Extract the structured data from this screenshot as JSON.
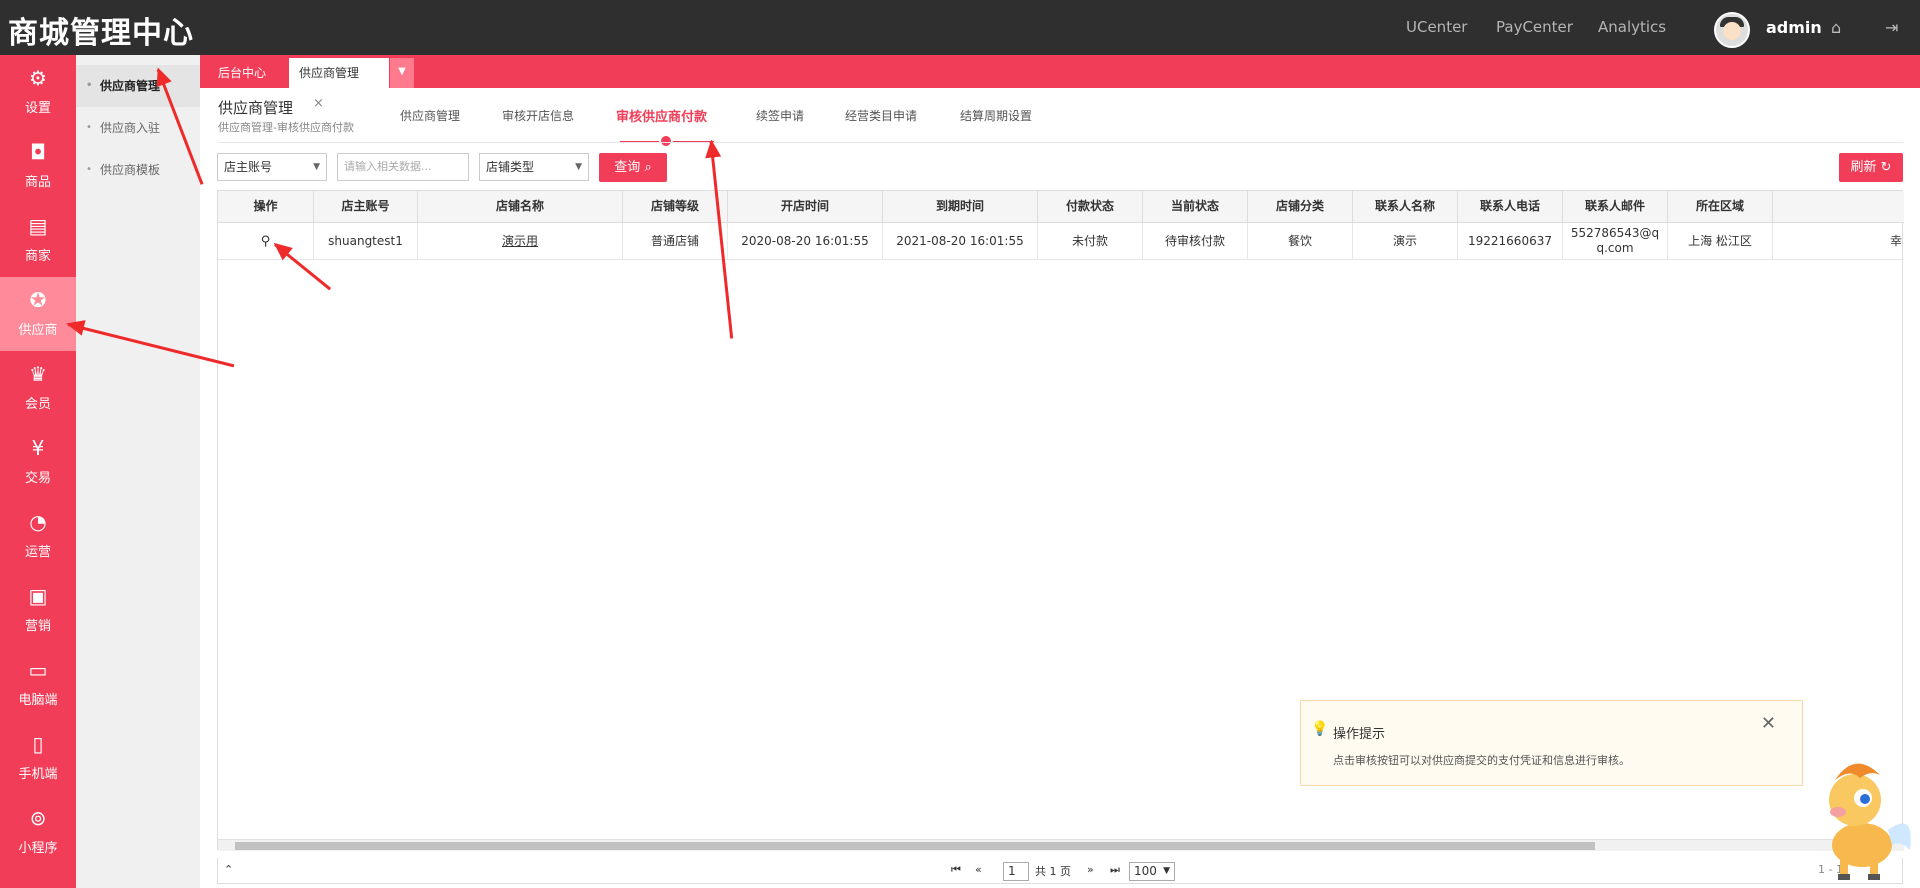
{
  "header": {
    "logo": "商城管理中心",
    "links": [
      "UCenter",
      "PayCenter",
      "Analytics"
    ],
    "user": "admin",
    "icons": [
      "home-icon",
      "logout-icon"
    ]
  },
  "sidebar": {
    "items": [
      {
        "label": "设置",
        "icon": "gear-icon"
      },
      {
        "label": "商品",
        "icon": "bag-icon"
      },
      {
        "label": "商家",
        "icon": "shop-icon"
      },
      {
        "label": "供应商",
        "icon": "badge-icon"
      },
      {
        "label": "会员",
        "icon": "crown-icon"
      },
      {
        "label": "交易",
        "icon": "yen-icon"
      },
      {
        "label": "运营",
        "icon": "pie-icon"
      },
      {
        "label": "营销",
        "icon": "promo-icon"
      },
      {
        "label": "电脑端",
        "icon": "monitor-icon"
      },
      {
        "label": "手机端",
        "icon": "phone-icon"
      },
      {
        "label": "小程序",
        "icon": "miniapp-icon"
      }
    ]
  },
  "subnav": {
    "items": [
      "供应商管理",
      "供应商入驻",
      "供应商模板"
    ]
  },
  "pagetabs": {
    "home": "后台中心",
    "current": "供应商管理"
  },
  "page": {
    "title": "供应商管理",
    "breadcrumb": "供应商管理-审核供应商付款"
  },
  "contenttabs": [
    "供应商管理",
    "审核开店信息",
    "审核供应商付款",
    "续签申请",
    "经营类目申请",
    "结算周期设置"
  ],
  "filters": {
    "owner_select": "店主账号",
    "search_placeholder": "请输入相关数据...",
    "shop_type_select": "店铺类型",
    "query_label": "查询",
    "refresh_label": "刷新"
  },
  "table": {
    "headers": [
      "操作",
      "店主账号",
      "店铺名称",
      "店铺等级",
      "开店时间",
      "到期时间",
      "付款状态",
      "当前状态",
      "店铺分类",
      "联系人名称",
      "联系人电话",
      "联系人邮件",
      "所在区域",
      ""
    ],
    "rows": [
      [
        "",
        "shuangtest1",
        "演示用",
        "普通店铺",
        "2020-08-20 16:01:55",
        "2021-08-20 16:01:55",
        "未付款",
        "待审核付款",
        "餐饮",
        "演示",
        "19221660637",
        "552786543@qq.com",
        "上海 松江区",
        "幸"
      ]
    ]
  },
  "pager": {
    "page_value": "1",
    "total_pages": "共 1 页",
    "page_size": "100",
    "summary": "1 - 1"
  },
  "tip": {
    "title": "操作提示",
    "content": "点击审核按钮可以对供应商提交的支付凭证和信息进行审核。"
  },
  "colors": {
    "accent": "#f23d58",
    "topbar": "#2f2f2f",
    "annotation": "#ef2a2a"
  }
}
